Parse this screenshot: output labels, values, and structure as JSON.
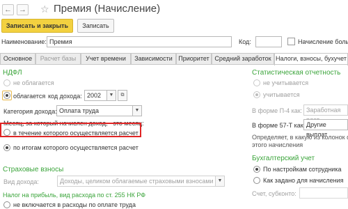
{
  "window": {
    "title": "Премия (Начисление)",
    "back_icon": "arrow-left-icon",
    "forward_icon": "arrow-right-icon",
    "favorite_icon": "star-icon"
  },
  "toolbar": {
    "save_close_label": "Записать и закрыть",
    "save_label": "Записать"
  },
  "form": {
    "name_label": "Наименование:",
    "name_value": "Премия",
    "code_label": "Код:",
    "code_value": "",
    "sick_checkbox_label": "Начисление больн"
  },
  "tabs": [
    {
      "label": "Основное",
      "state": "normal"
    },
    {
      "label": "Расчет базы",
      "state": "disabled"
    },
    {
      "label": "Учет времени",
      "state": "normal"
    },
    {
      "label": "Зависимости",
      "state": "normal"
    },
    {
      "label": "Приоритет",
      "state": "normal"
    },
    {
      "label": "Средний заработок",
      "state": "normal"
    },
    {
      "label": "Налоги, взносы, бухучет",
      "state": "active"
    }
  ],
  "ndfl": {
    "heading": "НДФЛ",
    "not_taxed": "не облагается",
    "taxed": "облагается",
    "income_code_label": "код дохода:",
    "income_code_value": "2002",
    "income_category_label": "Категория дохода:",
    "income_category_value": "Оплата труда",
    "month_question": "Месяц, за который начислен доход, - это месяц:",
    "option_during": "в течение которого осуществляется расчет",
    "option_result": "по итогам которого осуществляется расчет"
  },
  "insurance": {
    "heading": "Страховые взносы",
    "income_kind_label": "Вид дохода:",
    "income_kind_value": "Доходы, целиком облагаемые страховыми взносами"
  },
  "profit_tax": {
    "heading": "Налог на прибыль, вид расхода по ст. 255 НК РФ",
    "option_not_included": "не включается в расходы по оплате труда"
  },
  "stat": {
    "heading": "Статистическая отчетность",
    "not_counted": "не учитывается",
    "counted": "учитывается",
    "form_p4_label": "В форме П-4 как:",
    "form_p4_value": "Заработная плат",
    "form_57t_label": "В форме 57-Т как:",
    "form_57t_value": "Другие выплат",
    "note_line1": "Определяет, в какую из колонок ф",
    "note_line2": "этого начисления"
  },
  "accounting": {
    "heading": "Бухгалтерский учет",
    "by_employee": "По настройкам сотрудника",
    "as_in_accrual": "Как задано для начисления",
    "account_label": "Счет, субконто:"
  }
}
